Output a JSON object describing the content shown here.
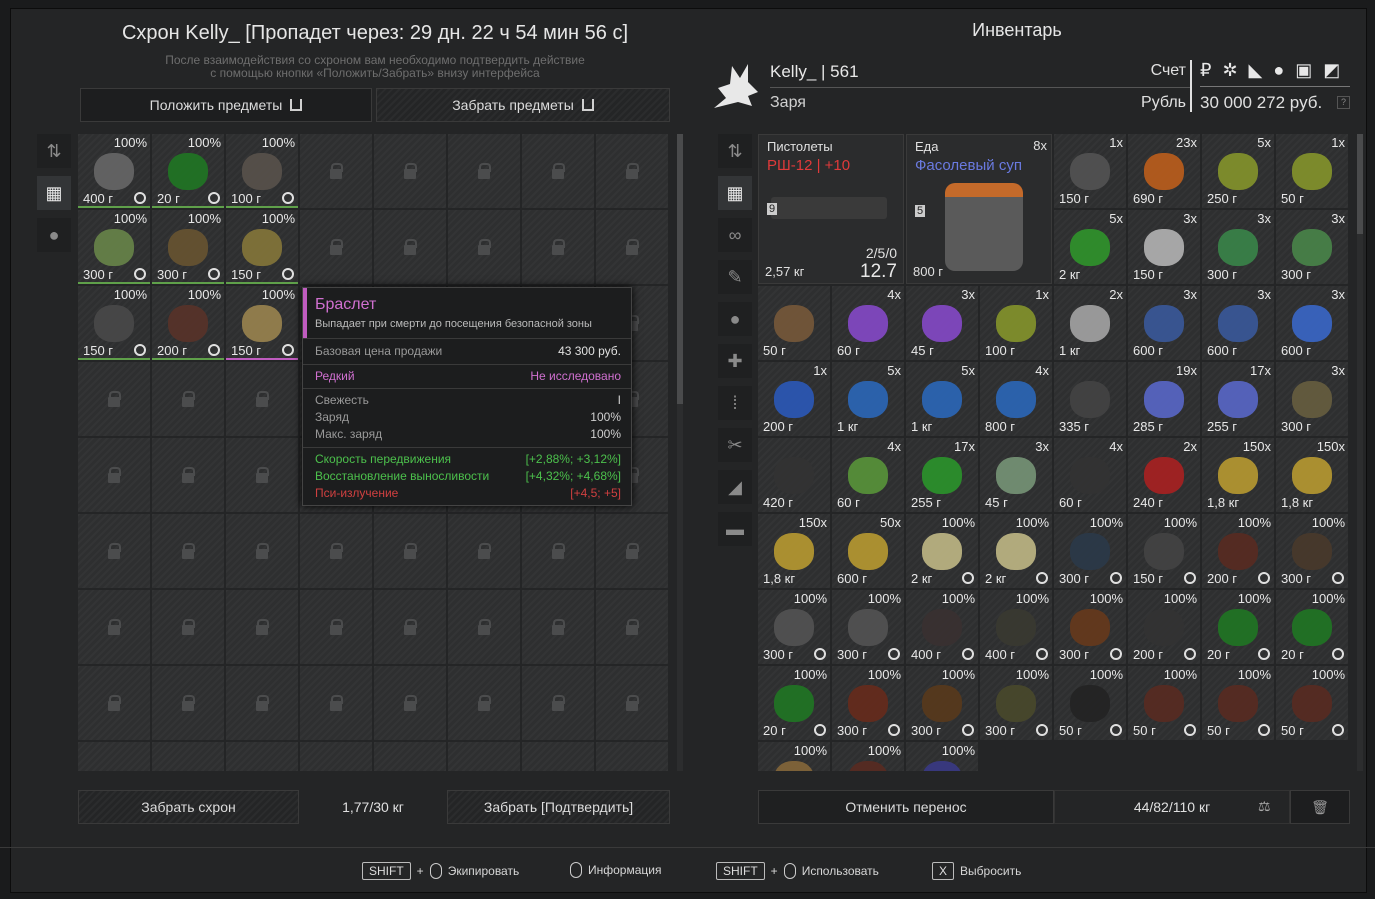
{
  "stash": {
    "title": "Схрон Kelly_ [Пропадет через: 29 дн. 22 ч 54 мин 56 с]",
    "hint_line1": "После взаимодействия со схроном вам необходимо подтвердить действие",
    "hint_line2": "с помощью кнопки «Положить/Забрать» внизу интерфейса",
    "put_label": "Положить предметы",
    "take_label": "Забрать предметы",
    "take_stash_label": "Забрать схрон",
    "weight": "1,77/30 кг",
    "confirm_label": "Забрать [Подтвердить]",
    "items": [
      {
        "top": "100%",
        "price": "400 г",
        "color": "#6a6a6a",
        "bar": "#5fa04a"
      },
      {
        "top": "100%",
        "price": "20 г",
        "color": "#1e7a22",
        "bar": "#5fa04a"
      },
      {
        "top": "100%",
        "price": "100 г",
        "color": "#5a544c",
        "bar": "#5fa04a"
      },
      {
        "top": "100%",
        "price": "300 г",
        "color": "#6b8a4a",
        "bar": "#5fa04a"
      },
      {
        "top": "100%",
        "price": "300 г",
        "color": "#6b5630",
        "bar": "#5fa04a"
      },
      {
        "top": "100%",
        "price": "150 г",
        "color": "#8a7a3a",
        "bar": "#5fa04a"
      },
      {
        "top": "100%",
        "price": "150 г",
        "color": "#4a4a4a",
        "bar": "#5fa04a"
      },
      {
        "top": "100%",
        "price": "200 г",
        "color": "#5a3328",
        "bar": "#5fa04a"
      },
      {
        "top": "100%",
        "price": "150 г",
        "color": "#a08850",
        "bar": "#c05cc0"
      }
    ]
  },
  "tooltip": {
    "name": "Браслет",
    "desc": "Выпадает при смерти до посещения безопасной зоны",
    "base_price_label": "Базовая цена продажи",
    "base_price": "43 300 руб.",
    "rarity": "Редкий",
    "research": "Не исследовано",
    "fresh_label": "Свежесть",
    "fresh_value": "I",
    "charge_label": "Заряд",
    "charge_value": "100%",
    "maxcharge_label": "Макс. заряд",
    "maxcharge_value": "100%",
    "stat1_label": "Скорость передвижения",
    "stat1_value": "[+2,88%; +3,12%]",
    "stat2_label": "Восстановление выносливости",
    "stat2_value": "[+4,32%; +4,68%]",
    "stat3_label": "Пси-излучение",
    "stat3_value": "[+4,5; +5]",
    "accent": "#c05cc0"
  },
  "inventory": {
    "title": "Инвентарь",
    "player": "Kelly_ | 561",
    "faction": "Заря",
    "account_label": "Счет",
    "currency_label": "Рубль",
    "money": "30 000 272 руб.",
    "cancel_label": "Отменить перенос",
    "weight": "44/82/110 кг",
    "pistol_cat": "Пистолеты",
    "pistol_name": "РШ-12 | +10",
    "pistol_ammo": "2/5/0",
    "pistol_dmg": "12.7",
    "pistol_weight": "2,57 кг",
    "pistol_lock": "9",
    "food_cat": "Еда",
    "food_count": "8x",
    "food_name": "Фасолевый суп",
    "food_lvl": "5",
    "food_price": "800 г",
    "items": [
      {
        "top": "1x",
        "price": "150 г",
        "color": "#555"
      },
      {
        "top": "23x",
        "price": "690 г",
        "color": "#c4601a"
      },
      {
        "top": "5x",
        "price": "250 г",
        "color": "#8a9a2a"
      },
      {
        "top": "1x",
        "price": "50 г",
        "color": "#8a9a2a"
      },
      {
        "top": "5x",
        "price": "2 кг",
        "color": "#2f9a2a"
      },
      {
        "top": "3x",
        "price": "150 г",
        "color": "#bbb"
      },
      {
        "top": "3x",
        "price": "300 г",
        "color": "#3a8a4a"
      },
      {
        "top": "3x",
        "price": "300 г",
        "color": "#4a8a4a"
      },
      {
        "top": "",
        "price": "50 г",
        "color": "#7a5a3a"
      },
      {
        "top": "4x",
        "price": "60 г",
        "color": "#8a4ad0"
      },
      {
        "top": "3x",
        "price": "45 г",
        "color": "#8a4ad0"
      },
      {
        "top": "1x",
        "price": "100 г",
        "color": "#8a9a2a"
      },
      {
        "top": "2x",
        "price": "1 кг",
        "color": "#aaa"
      },
      {
        "top": "3x",
        "price": "600 г",
        "color": "#3a5aa0"
      },
      {
        "top": "3x",
        "price": "600 г",
        "color": "#3a5aa0"
      },
      {
        "top": "3x",
        "price": "600 г",
        "color": "#3a6ad0"
      },
      {
        "top": "1x",
        "price": "200 г",
        "color": "#2a5ac0"
      },
      {
        "top": "5x",
        "price": "1 кг",
        "color": "#2a6ac0"
      },
      {
        "top": "5x",
        "price": "1 кг",
        "color": "#2a6ac0"
      },
      {
        "top": "4x",
        "price": "800 г",
        "color": "#2a6ac0"
      },
      {
        "top": "",
        "price": "335 г",
        "color": "#444"
      },
      {
        "top": "19x",
        "price": "285 г",
        "color": "#5a6ad0"
      },
      {
        "top": "17x",
        "price": "255 г",
        "color": "#5a6ad0"
      },
      {
        "top": "3x",
        "price": "300 г",
        "color": "#6a6040"
      },
      {
        "top": "",
        "price": "420 г",
        "color": "#333"
      },
      {
        "top": "4x",
        "price": "60 г",
        "color": "#5a9a3a"
      },
      {
        "top": "17x",
        "price": "255 г",
        "color": "#2a9a2a"
      },
      {
        "top": "3x",
        "price": "45 г",
        "color": "#7a9a7a"
      },
      {
        "top": "4x",
        "price": "60 г",
        "color": "#333"
      },
      {
        "top": "2x",
        "price": "240 г",
        "color": "#b02020"
      },
      {
        "top": "150x",
        "price": "1,8 кг",
        "color": "#c0a030"
      },
      {
        "top": "150x",
        "price": "1,8 кг",
        "color": "#c0a030"
      },
      {
        "top": "150x",
        "price": "1,8 кг",
        "color": "#c0a030"
      },
      {
        "top": "50x",
        "price": "600 г",
        "color": "#c0a030"
      },
      {
        "top": "100%",
        "price": "2 кг",
        "color": "#c8c08a"
      },
      {
        "top": "100%",
        "price": "2 кг",
        "color": "#c8c08a"
      },
      {
        "top": "100%",
        "price": "300 г",
        "color": "#2a3a4a"
      },
      {
        "top": "100%",
        "price": "150 г",
        "color": "#444"
      },
      {
        "top": "100%",
        "price": "200 г",
        "color": "#5a2a20"
      },
      {
        "top": "100%",
        "price": "300 г",
        "color": "#4a3a2a"
      },
      {
        "top": "100%",
        "price": "300 г",
        "color": "#555"
      },
      {
        "top": "100%",
        "price": "300 г",
        "color": "#555"
      },
      {
        "top": "100%",
        "price": "400 г",
        "color": "#3a3030"
      },
      {
        "top": "100%",
        "price": "400 г",
        "color": "#3a3a30"
      },
      {
        "top": "100%",
        "price": "300 г",
        "color": "#6a3a1a"
      },
      {
        "top": "100%",
        "price": "200 г",
        "color": "#333"
      },
      {
        "top": "100%",
        "price": "20 г",
        "color": "#1e7a22"
      },
      {
        "top": "100%",
        "price": "20 г",
        "color": "#1e7a22"
      },
      {
        "top": "100%",
        "price": "20 г",
        "color": "#1e7a22"
      },
      {
        "top": "100%",
        "price": "300 г",
        "color": "#6a2a1a"
      },
      {
        "top": "100%",
        "price": "300 г",
        "color": "#5a3a1a"
      },
      {
        "top": "100%",
        "price": "300 г",
        "color": "#4a4a2a"
      },
      {
        "top": "100%",
        "price": "50 г",
        "color": "#222"
      },
      {
        "top": "100%",
        "price": "50 г",
        "color": "#5a2a20"
      },
      {
        "top": "100%",
        "price": "50 г",
        "color": "#5a2a20"
      },
      {
        "top": "100%",
        "price": "50 г",
        "color": "#5a2a20"
      },
      {
        "top": "100%",
        "price": "",
        "color": "#8a6a3a"
      },
      {
        "top": "100%",
        "price": "",
        "color": "#5a2a20"
      },
      {
        "top": "100%",
        "price": "",
        "color": "#3a3a8a"
      }
    ]
  },
  "footer": {
    "shift": "SHIFT",
    "plus": "+",
    "equip": "Экипировать",
    "info": "Информация",
    "use": "Использовать",
    "x_key": "X",
    "drop": "Выбросить"
  }
}
